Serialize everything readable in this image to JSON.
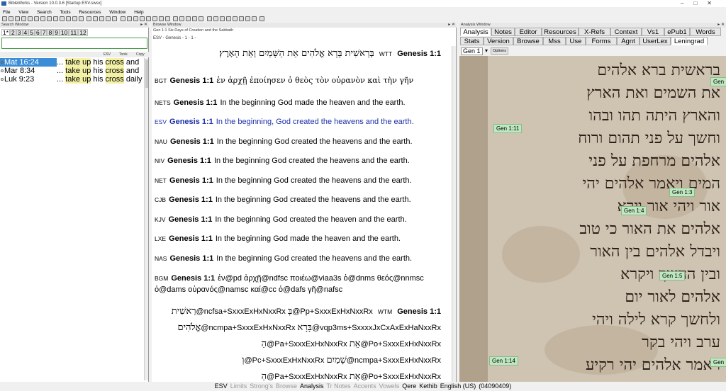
{
  "window": {
    "title": "BibleWorks - Version 10.0.3.6 [Startup ESV.swsx]"
  },
  "menu": [
    "File",
    "View",
    "Search",
    "Tools",
    "Resources",
    "Window",
    "Help"
  ],
  "search_window": {
    "header": "Search Window",
    "tabs": [
      "1*",
      "2",
      "3",
      "4",
      "5",
      "6",
      "7",
      "8",
      "9",
      "10",
      "11",
      "12"
    ],
    "toolbar": {
      "version": "ESV",
      "tools": "Tools",
      "copy": "Copy"
    },
    "results": [
      {
        "ref": "Mat 16:24",
        "pre": "... ",
        "hl1": "take up",
        "mid": " his ",
        "hl2": "cross",
        "post": " and"
      },
      {
        "ref": "Mar 8:34",
        "pre": "... ",
        "hl1": "take up",
        "mid": " his ",
        "hl2": "cross",
        "post": " and"
      },
      {
        "ref": "Luk 9:23",
        "pre": "... ",
        "hl1": "take up",
        "mid": " his ",
        "hl2": "cross",
        "post": " daily"
      }
    ]
  },
  "browse_window": {
    "header": "Browse Window",
    "description": "Gen 1:1 Six Days of Creation and the Sabbath",
    "version_line": "ESV - Genesis - 1 - 1 -",
    "wtt": {
      "abbr": "WTT",
      "ref": "Genesis 1:1",
      "text": "בְּרֵאשִׁית בָּרָא אֱלֹהִים אֵת הַשָּׁמַיִם וְאֵת הָאָרֶץ׃"
    },
    "bgt": {
      "abbr": "BGT",
      "ref": "Genesis 1:1",
      "text": "ἐν ἀρχῇ ἐποίησεν ὁ θεὸς τὸν οὐρανὸν καὶ τὴν γῆν"
    },
    "verses": [
      {
        "abbr": "NETS",
        "ref": "Genesis 1:1",
        "text": "In the beginning God made the heaven and the earth."
      },
      {
        "abbr": "ESV",
        "ref": "Genesis 1:1",
        "text": "In the beginning, God created the heavens and the earth."
      },
      {
        "abbr": "NAU",
        "ref": "Genesis 1:1",
        "text": "In the beginning God created the heavens and the earth."
      },
      {
        "abbr": "NIV",
        "ref": "Genesis 1:1",
        "text": "In the beginning God created the heavens and the earth."
      },
      {
        "abbr": "NET",
        "ref": "Genesis 1:1",
        "text": "In the beginning God created the heavens and the earth."
      },
      {
        "abbr": "CJB",
        "ref": "Genesis 1:1",
        "text": "In the beginning God created the heavens and the earth."
      },
      {
        "abbr": "KJV",
        "ref": "Genesis 1:1",
        "text": "In the beginning God created the heaven and the earth."
      },
      {
        "abbr": "LXE",
        "ref": "Genesis 1:1",
        "text": "In the beginning God made the heaven and the earth."
      },
      {
        "abbr": "NAS",
        "ref": "Genesis 1:1",
        "text": "In the beginning God created the heavens and the earth."
      }
    ],
    "bgm": {
      "abbr": "BGM",
      "ref": "Genesis 1:1",
      "line1": "ἐν@pd ἀρχῇ@ndfsc ποιέω@viaa3s ὁ@dnms θεός@nnmsc",
      "line2": "ὁ@dams οὐρανός@namsc καί@cc ὁ@dafs γῆ@nafsc"
    },
    "wtm": {
      "abbr": "WTM",
      "ref": "Genesis 1:1",
      "lines": [
        {
          "heb": "רֵאשִׁית",
          "tag": "@ncfsa+SxxxExHxNxxRx",
          "heb2": "בְּ",
          "tag2": "@Pp+SxxxExHxNxxRx"
        },
        {
          "heb": "אֱלֹהִים",
          "tag": "@ncmpa+SxxxExHxNxxRx",
          "heb2": "בָּרָא",
          "tag2": "@vqp3ms+SxxxxJxCxAxExHaNxxRx"
        },
        {
          "heb": "הַ",
          "tag": "@Pa+SxxxExHxNxxRx",
          "heb2": "אֵת",
          "tag2": "@Po+SxxxExHxNxxRx"
        },
        {
          "heb": "וְ",
          "tag": "@Pc+SxxxExHxNxxRx",
          "heb2": "שָׁמַיִם",
          "tag2": "@ncmpa+SxxxExHxNxxRx"
        },
        {
          "heb": "הַ",
          "tag": "@Pa+SxxxExHxNxxRx",
          "heb2": "אֵת",
          "tag2": "@Po+SxxxExHxNxxRx"
        }
      ]
    }
  },
  "analysis_window": {
    "header": "Analysis Window",
    "tabs_row1": [
      "Analysis",
      "Notes",
      "Editor",
      "Resources",
      "X-Refs",
      "Context",
      "Vs1",
      "ePub1",
      "Words"
    ],
    "tabs_row2": [
      "Stats",
      "Version",
      "Browse",
      "Mss",
      "Use",
      "Forms",
      "Agnt",
      "UserLex",
      "Leningrad"
    ],
    "active_tab_row1": "Analysis",
    "active_tab_row2": "Leningrad",
    "chapter_select": "Gen 1",
    "options_label": "Options",
    "manuscript_labels": [
      "Gen 1:11",
      "Gen 1:3",
      "Gen 1:4",
      "Gen 1:5",
      "Gen 1:14",
      "Gen"
    ],
    "manuscript_lines": [
      "בראשית ברא אלהים",
      "את השמים ואת הארץ",
      "והארץ היתה תהו ובהו",
      "וחשך על פני תהום ורוח",
      "אלהים מרחפת על פני",
      "המים ויאמר אלהים יהי",
      "אור ויהי אור וירא",
      "אלהים את האור כי טוב",
      "ויבדל אלהים בין האור",
      "ובין החשך ויקרא",
      "אלהים לאור יום",
      "ולחשך קרא לילה ויהי",
      "ערב ויהי בקר",
      "ויאמר אלהים יהי רקיע"
    ]
  },
  "status_bar": [
    {
      "label": "ESV",
      "active": true
    },
    {
      "label": "Limits",
      "active": false
    },
    {
      "label": "Strong's",
      "active": false
    },
    {
      "label": "Browse",
      "active": false
    },
    {
      "label": "Analysis",
      "active": true
    },
    {
      "label": "Tr Notes",
      "active": false
    },
    {
      "label": "Accents",
      "active": false
    },
    {
      "label": "Vowels",
      "active": false
    },
    {
      "label": "Qere",
      "active": true
    },
    {
      "label": "Kethib",
      "active": true
    },
    {
      "label": "English (US)",
      "active": true
    },
    {
      "label": "(04090409)",
      "active": true
    }
  ]
}
